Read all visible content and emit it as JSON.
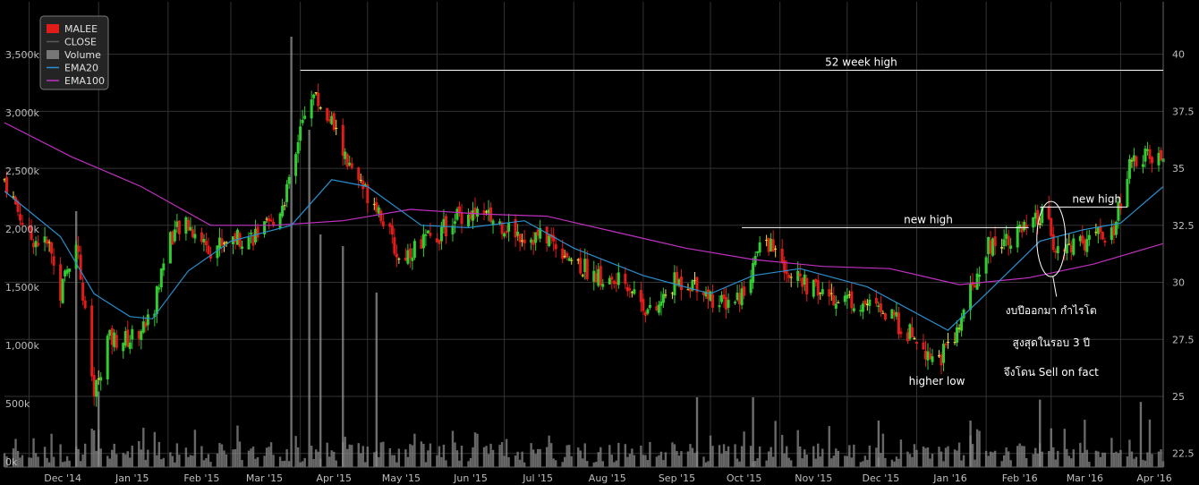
{
  "chart_data": {
    "type": "candlestick",
    "legend": [
      "MALEE",
      "CLOSE",
      "Volume",
      "EMA20",
      "EMA100"
    ],
    "legend_placement": "top-left",
    "colors": {
      "background": "#000000",
      "grid": "#333333",
      "up": "#33cc33",
      "down": "#e21b1b",
      "doji": "#f0e040",
      "volume": "#8a8a8a",
      "ema20": "#2a8fd0",
      "ema100": "#c030c0",
      "annotation": "#ffffff"
    },
    "x_tick_labels": [
      "Dec '14",
      "Jan '15",
      "Feb '15",
      "Mar '15",
      "Apr '15",
      "May '15",
      "Jun '15",
      "Jul '15",
      "Aug '15",
      "Sep '15",
      "Oct '15",
      "Nov '15",
      "Dec '15",
      "Jan '16",
      "Feb '16",
      "Mar '16",
      "Apr '16"
    ],
    "x_range": [
      "2014-11-20",
      "2016-04-20"
    ],
    "price_axis": {
      "position": "right",
      "ticks": [
        "22.5",
        "25",
        "27.5",
        "30",
        "32.5",
        "35",
        "37.5",
        "40"
      ],
      "ylim": [
        21.9,
        42.3
      ]
    },
    "volume_axis": {
      "position": "left",
      "ticks": [
        "0k",
        "500k",
        "1,000k",
        "1,500k",
        "2,000k",
        "2,500k",
        "3,000k",
        "3,500k"
      ],
      "ylim": [
        0,
        4000000
      ]
    },
    "grid": true,
    "annotations": [
      {
        "text": "52 week high",
        "type": "hline",
        "value": 39.3,
        "from": "2015-04-01",
        "to": "2016-04-20"
      },
      {
        "text": "new high",
        "type": "hline",
        "value": 32.4,
        "from": "2015-10-15",
        "to": "2016-02-20"
      },
      {
        "text": "new high",
        "type": "hline",
        "value": 33.3,
        "from": "2016-02-25",
        "to": "2016-04-04"
      },
      {
        "text": "higher low",
        "type": "label",
        "x": "2016-01-10",
        "value": 25.5
      },
      {
        "text": "งบปีออกมา กำไรโต",
        "type": "label",
        "x": "2016-03-01",
        "value": 28.6
      },
      {
        "text": "สูงสุดในรอบ 3 ปี",
        "type": "label",
        "x": "2016-03-01",
        "value": 27.2
      },
      {
        "text": "จึงโดน Sell on fact",
        "type": "label",
        "x": "2016-03-01",
        "value": 25.9
      }
    ],
    "price_points": [
      [
        "2014-11-20",
        34.5
      ],
      [
        "2014-12-01",
        32.0
      ],
      [
        "2014-12-10",
        31.6
      ],
      [
        "2014-12-15",
        29.5
      ],
      [
        "2014-12-22",
        32.0
      ],
      [
        "2014-12-30",
        25.0
      ],
      [
        "2015-01-05",
        27.5
      ],
      [
        "2015-01-15",
        27.5
      ],
      [
        "2015-01-25",
        28.5
      ],
      [
        "2015-02-01",
        32.0
      ],
      [
        "2015-02-10",
        32.5
      ],
      [
        "2015-02-20",
        31.5
      ],
      [
        "2015-03-01",
        32.0
      ],
      [
        "2015-03-10",
        32.0
      ],
      [
        "2015-03-20",
        32.5
      ],
      [
        "2015-03-28",
        34.5
      ],
      [
        "2015-04-05",
        38.5
      ],
      [
        "2015-04-15",
        37.0
      ],
      [
        "2015-04-25",
        34.5
      ],
      [
        "2015-05-05",
        33.5
      ],
      [
        "2015-05-15",
        31.0
      ],
      [
        "2015-05-25",
        31.8
      ],
      [
        "2015-06-01",
        32.0
      ],
      [
        "2015-06-10",
        33.0
      ],
      [
        "2015-06-20",
        33.0
      ],
      [
        "2015-07-01",
        32.5
      ],
      [
        "2015-07-10",
        32.0
      ],
      [
        "2015-07-20",
        32.0
      ],
      [
        "2015-08-01",
        31.0
      ],
      [
        "2015-08-15",
        30.0
      ],
      [
        "2015-08-25",
        30.0
      ],
      [
        "2015-09-05",
        28.5
      ],
      [
        "2015-09-15",
        30.0
      ],
      [
        "2015-09-25",
        30.0
      ],
      [
        "2015-10-05",
        29.0
      ],
      [
        "2015-10-15",
        29.5
      ],
      [
        "2015-10-25",
        32.0
      ],
      [
        "2015-11-01",
        31.0
      ],
      [
        "2015-11-10",
        30.0
      ],
      [
        "2015-11-20",
        29.5
      ],
      [
        "2015-12-01",
        29.3
      ],
      [
        "2015-12-10",
        29.0
      ],
      [
        "2015-12-20",
        28.5
      ],
      [
        "2016-01-01",
        27.5
      ],
      [
        "2016-01-10",
        26.5
      ],
      [
        "2016-01-18",
        27.5
      ],
      [
        "2016-01-25",
        29.5
      ],
      [
        "2016-02-01",
        31.5
      ],
      [
        "2016-02-10",
        32.0
      ],
      [
        "2016-02-20",
        32.3
      ],
      [
        "2016-02-27",
        33.0
      ],
      [
        "2016-03-03",
        31.5
      ],
      [
        "2016-03-10",
        31.5
      ],
      [
        "2016-03-20",
        32.0
      ],
      [
        "2016-03-28",
        32.0
      ],
      [
        "2016-04-05",
        35.0
      ],
      [
        "2016-04-10",
        35.5
      ],
      [
        "2016-04-20",
        35.3
      ]
    ],
    "ema20_points": [
      [
        "2014-11-20",
        34.0
      ],
      [
        "2014-12-15",
        32.0
      ],
      [
        "2014-12-30",
        29.5
      ],
      [
        "2015-01-15",
        28.5
      ],
      [
        "2015-01-25",
        28.4
      ],
      [
        "2015-02-10",
        30.5
      ],
      [
        "2015-03-01",
        31.8
      ],
      [
        "2015-03-28",
        32.5
      ],
      [
        "2015-04-15",
        34.5
      ],
      [
        "2015-05-01",
        34.2
      ],
      [
        "2015-05-25",
        32.5
      ],
      [
        "2015-06-15",
        32.4
      ],
      [
        "2015-07-10",
        32.7
      ],
      [
        "2015-08-01",
        31.5
      ],
      [
        "2015-09-01",
        30.3
      ],
      [
        "2015-10-01",
        29.5
      ],
      [
        "2015-10-20",
        30.3
      ],
      [
        "2015-11-10",
        30.6
      ],
      [
        "2015-12-10",
        29.8
      ],
      [
        "2016-01-15",
        27.9
      ],
      [
        "2016-02-01",
        29.5
      ],
      [
        "2016-02-25",
        31.8
      ],
      [
        "2016-03-15",
        32.3
      ],
      [
        "2016-04-01",
        32.6
      ],
      [
        "2016-04-20",
        34.2
      ]
    ],
    "ema100_points": [
      [
        "2014-11-20",
        37.0
      ],
      [
        "2014-12-20",
        35.5
      ],
      [
        "2015-01-20",
        34.2
      ],
      [
        "2015-02-20",
        32.5
      ],
      [
        "2015-03-20",
        32.5
      ],
      [
        "2015-04-20",
        32.7
      ],
      [
        "2015-05-20",
        33.2
      ],
      [
        "2015-06-20",
        33.0
      ],
      [
        "2015-07-20",
        32.9
      ],
      [
        "2015-08-20",
        32.2
      ],
      [
        "2015-09-20",
        31.5
      ],
      [
        "2015-10-20",
        31.0
      ],
      [
        "2015-11-20",
        30.7
      ],
      [
        "2015-12-20",
        30.6
      ],
      [
        "2016-01-20",
        29.9
      ],
      [
        "2016-02-20",
        30.2
      ],
      [
        "2016-03-20",
        30.8
      ],
      [
        "2016-04-20",
        31.7
      ]
    ],
    "volume_spikes": [
      [
        "2014-12-22",
        2200000
      ],
      [
        "2015-01-01",
        650000
      ],
      [
        "2015-03-28",
        3700000
      ],
      [
        "2015-04-05",
        2900000
      ],
      [
        "2015-04-10",
        2000000
      ],
      [
        "2015-04-20",
        1900000
      ],
      [
        "2015-05-05",
        1500000
      ],
      [
        "2015-09-25",
        600000
      ],
      [
        "2015-10-20",
        600000
      ],
      [
        "2015-12-15",
        400000
      ],
      [
        "2016-01-25",
        400000
      ],
      [
        "2016-02-25",
        580000
      ],
      [
        "2016-04-10",
        560000
      ]
    ]
  }
}
